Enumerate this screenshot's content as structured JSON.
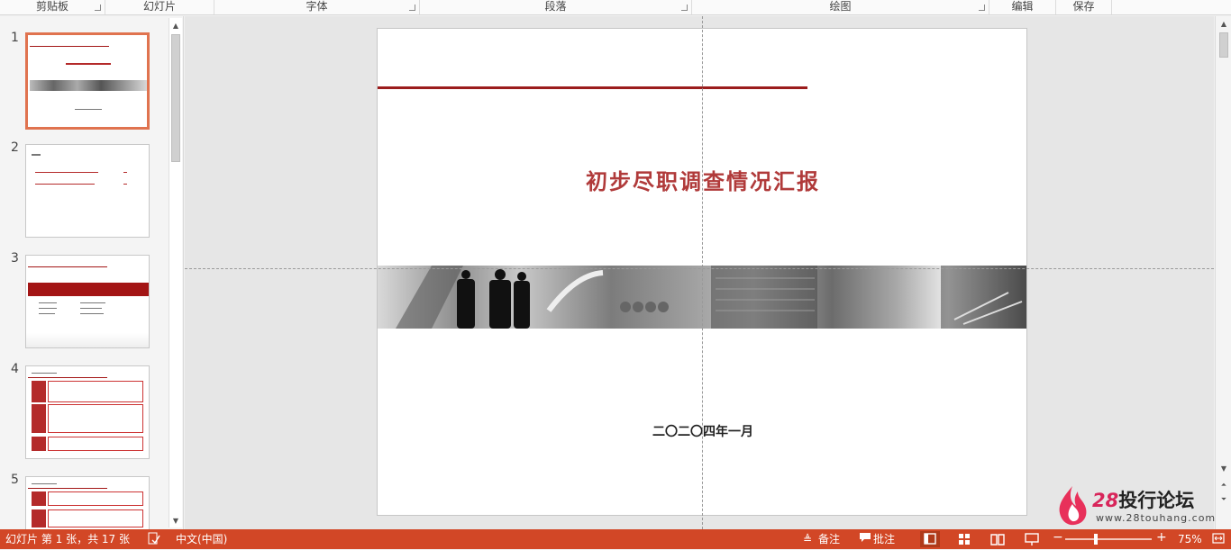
{
  "ribbon": {
    "groups": [
      {
        "label": "剪贴板"
      },
      {
        "label": "幻灯片"
      },
      {
        "label": "字体"
      },
      {
        "label": "段落"
      },
      {
        "label": "绘图"
      },
      {
        "label": "编辑"
      },
      {
        "label": "保存"
      }
    ]
  },
  "thumbnails": [
    {
      "number": "1"
    },
    {
      "number": "2"
    },
    {
      "number": "3"
    },
    {
      "number": "4"
    },
    {
      "number": "5"
    }
  ],
  "slide": {
    "title": "初步尽职调查情况汇报",
    "date": "二〇二〇四年一月"
  },
  "watermark": {
    "number": "28",
    "text": "投行论坛",
    "url": "www.28touhang.com"
  },
  "status": {
    "slide_info": "幻灯片 第 1 张，共 17 张",
    "language": "中文(中国)",
    "notes": "备注",
    "comments": "批注",
    "zoom": "75%"
  },
  "colors": {
    "accent": "#d24726",
    "title_red": "#b03a3a",
    "line_red": "#9b1c1c"
  }
}
